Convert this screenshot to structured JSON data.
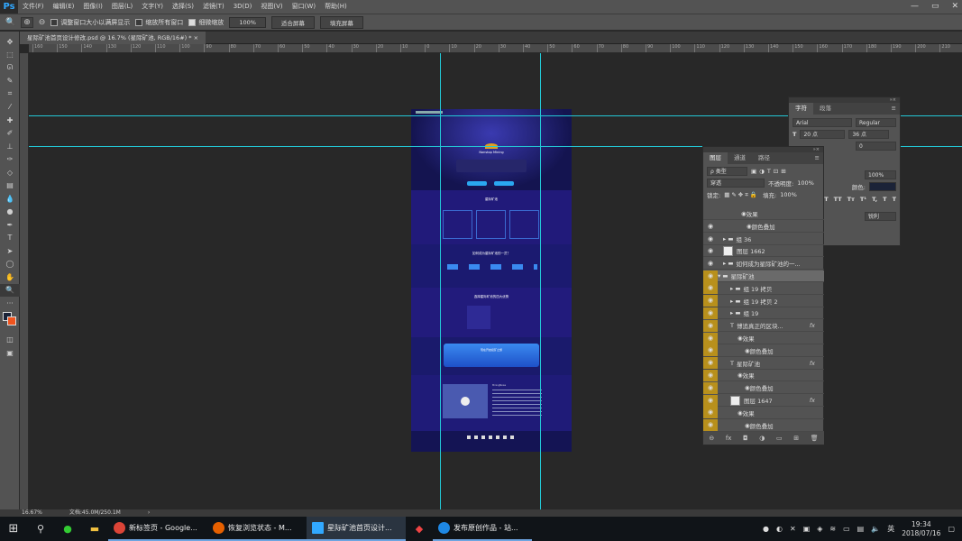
{
  "app": {
    "logo": "Ps",
    "menus": [
      "文件(F)",
      "编辑(E)",
      "图像(I)",
      "图层(L)",
      "文字(Y)",
      "选择(S)",
      "滤镜(T)",
      "3D(D)",
      "视图(V)",
      "窗口(W)",
      "帮助(H)"
    ],
    "window_controls": [
      "—",
      "▭",
      "✕"
    ]
  },
  "options": {
    "tool_icons": [
      "🔍",
      "⊕",
      "⊖"
    ],
    "resize_windows": "调整窗口大小以满屏显示",
    "zoom_all": "缩放所有窗口",
    "scrubby_zoom": "细微缩放",
    "zoom_value": "100%",
    "fit_screen": "适合屏幕",
    "fill_screen": "填充屏幕"
  },
  "document": {
    "tab_title": "星际矿池首页设计修改.psd @ 16.7% (星际矿池, RGB/16#) *",
    "tab_close": "×"
  },
  "ruler": {
    "top": [
      "160",
      "150",
      "140",
      "130",
      "120",
      "110",
      "100",
      "90",
      "80",
      "70",
      "60",
      "50",
      "40",
      "30",
      "20",
      "10",
      "0",
      "10",
      "20",
      "30",
      "40",
      "50",
      "60",
      "70",
      "80",
      "90",
      "100",
      "110",
      "120",
      "130",
      "140",
      "150",
      "160",
      "170",
      "180",
      "190",
      "200",
      "210",
      "220",
      "230"
    ]
  },
  "status": {
    "zoom": "16.67%",
    "doc": "文档:45.0M/250.1M",
    "arrow": "›"
  },
  "artboard": {
    "hero_title": "Nonstop Mining",
    "features_title": "星际矿池",
    "how_title": "如何成为星际矿池的一员？",
    "why_title": "选择星际矿池的四大优势",
    "cta_title": "现在开启挖矿之旅",
    "news_title": "MiningNews"
  },
  "character_panel": {
    "tabs": [
      "字符",
      "段落"
    ],
    "font": "Arial",
    "style": "Regular",
    "size": "20 点",
    "leading": "36 点",
    "tracking": "0",
    "scale": "100%",
    "color_label": "颜色:",
    "aa": "锐利",
    "styles": [
      "T",
      "T",
      "TT",
      "Tт",
      "T¹",
      "T,",
      "T",
      "T"
    ],
    "menu": "≡"
  },
  "layers_panel": {
    "tabs": [
      "图层",
      "通道",
      "路径"
    ],
    "filter": "ρ 类型",
    "blend": "穿透",
    "opacity_label": "不透明度:",
    "opacity": "100%",
    "lock_label": "锁定:",
    "fill_label": "填充:",
    "fill": "100%",
    "menu": "≡",
    "layers": [
      {
        "name": "效果",
        "indent": 40,
        "eye": false,
        "kind": "sub"
      },
      {
        "name": "颜色叠加",
        "indent": 46,
        "eye": true,
        "kind": "sub"
      },
      {
        "name": "组 36",
        "indent": 20,
        "eye": true,
        "kind": "folder"
      },
      {
        "name": "图层 1662",
        "indent": 20,
        "eye": true,
        "kind": "img"
      },
      {
        "name": "如何成为星际矿池的一...",
        "indent": 20,
        "eye": true,
        "kind": "folder"
      },
      {
        "name": "星际矿池",
        "indent": 12,
        "eye": true,
        "kind": "folder-open",
        "hl": true
      },
      {
        "name": "组 19 拷贝",
        "indent": 28,
        "eye": true,
        "kind": "folder",
        "hl": true
      },
      {
        "name": "组 19 拷贝 2",
        "indent": 28,
        "eye": true,
        "kind": "folder",
        "hl": true
      },
      {
        "name": "组 19",
        "indent": 28,
        "eye": true,
        "kind": "folder",
        "hl": true
      },
      {
        "name": "博追真正的区块...",
        "indent": 28,
        "eye": true,
        "kind": "text",
        "hl": true,
        "fx": "fx"
      },
      {
        "name": "效果",
        "indent": 36,
        "eye": true,
        "kind": "sub",
        "hl": true
      },
      {
        "name": "颜色叠加",
        "indent": 44,
        "eye": true,
        "kind": "sub",
        "hl": true
      },
      {
        "name": "星际矿池",
        "indent": 28,
        "eye": true,
        "kind": "text",
        "hl": true,
        "fx": "fx"
      },
      {
        "name": "效果",
        "indent": 36,
        "eye": true,
        "kind": "sub",
        "hl": true
      },
      {
        "name": "颜色叠加",
        "indent": 44,
        "eye": true,
        "kind": "sub",
        "hl": true
      },
      {
        "name": "图层 1647",
        "indent": 28,
        "eye": true,
        "kind": "img",
        "hl": true,
        "fx": "fx"
      },
      {
        "name": "效果",
        "indent": 36,
        "eye": true,
        "kind": "sub",
        "hl": true
      },
      {
        "name": "颜色叠加",
        "indent": 44,
        "eye": true,
        "kind": "sub",
        "hl": true
      }
    ],
    "footer_icons": [
      "⊖",
      "fx",
      "◘",
      "◑",
      "▭",
      "⊞",
      "🗑"
    ]
  },
  "taskbar": {
    "apps": [
      {
        "label": "新标签页 - Google...",
        "color": "#db4437"
      },
      {
        "label": "恢复浏览状态 - M...",
        "color": "#e66000"
      },
      {
        "label": "星际矿池首页设计...",
        "color": "#31a8ff"
      },
      {
        "label": "发布原创作品 - 站...",
        "color": "#1e88e5"
      }
    ],
    "ime": "英",
    "time": "19:34",
    "date": "2018/07/16"
  }
}
